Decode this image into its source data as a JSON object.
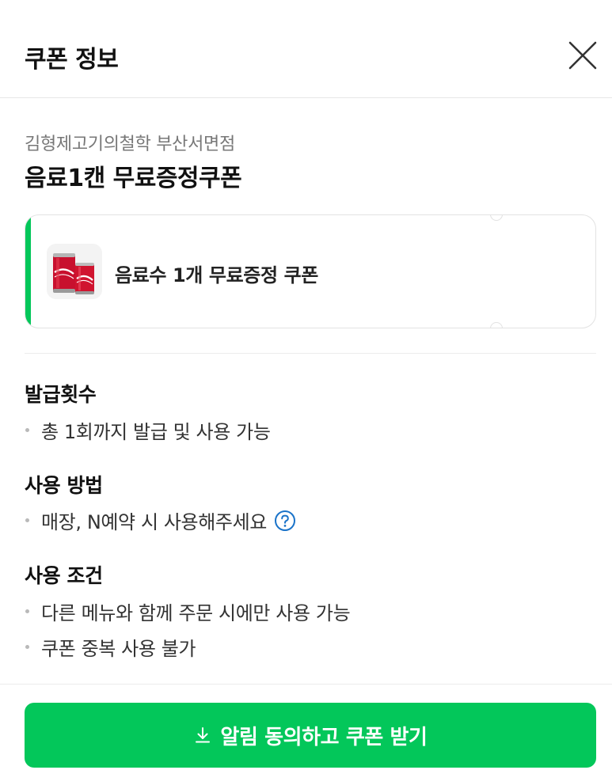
{
  "header": {
    "title": "쿠폰 정보",
    "close_icon": "close-icon"
  },
  "store": {
    "name": "김형제고기의철학 부산서면점"
  },
  "coupon": {
    "title": "음료1캔 무료증정쿠폰",
    "card_label": "음료수 1개 무료증정 쿠폰",
    "thumbnail": "cola-cans-image",
    "accent_color": "#03c75a"
  },
  "sections": [
    {
      "heading": "발급횟수",
      "items": [
        "총 1회까지 발급 및 사용 가능"
      ]
    },
    {
      "heading": "사용 방법",
      "items": [
        "매장, N예약 시 사용해주세요"
      ],
      "help_icon": "question-circle-icon"
    },
    {
      "heading": "사용 조건",
      "items": [
        "다른 메뉴와 함께 주문 시에만 사용 가능",
        "쿠폰 중복 사용 불가"
      ]
    }
  ],
  "cta": {
    "label": "알림 동의하고 쿠폰 받기",
    "icon": "download-icon",
    "color": "#03c75a"
  }
}
